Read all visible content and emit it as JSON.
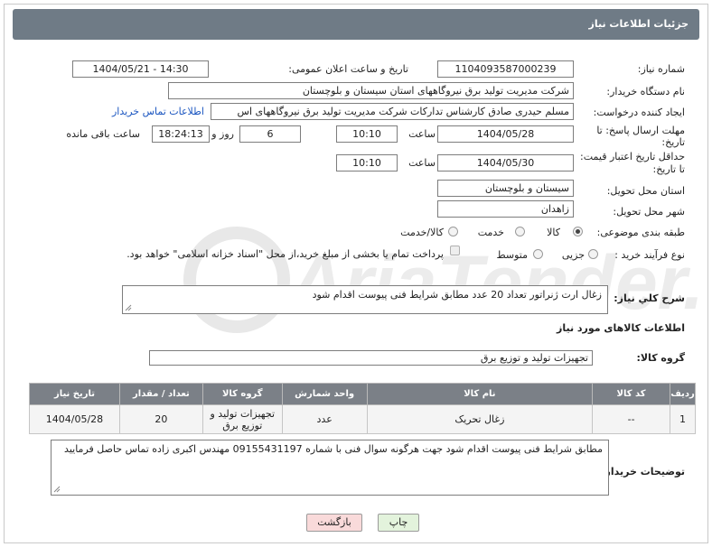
{
  "header": {
    "title": "جزئیات اطلاعات نیاز"
  },
  "fields": {
    "need_number_label": "شماره نیاز:",
    "need_number": "1104093587000239",
    "announce_label": "تاریخ و ساعت اعلان عمومی:",
    "announce_value": "1404/05/21 - 14:30",
    "buyer_org_label": "نام دستگاه خریدار:",
    "buyer_org": "شرکت مدیریت تولید برق نیروگاههای استان سیستان و بلوچستان",
    "creator_label": "ایجاد کننده درخواست:",
    "creator": "مسلم حیدری صادق کارشناس تدارکات شرکت مدیریت تولید برق نیروگاههای اس",
    "contact_link": "اطلاعات تماس خریدار",
    "reply_deadline_label_1": "مهلت ارسال پاسخ: تا",
    "reply_deadline_label_2": "تاریخ:",
    "reply_date": "1404/05/28",
    "time_label": "ساعت",
    "reply_time": "10:10",
    "days_value": "6",
    "days_label": "روز و",
    "remaining_time": "18:24:13",
    "remaining_label": "ساعت باقی مانده",
    "price_deadline_label_1": "حداقل تاریخ اعتبار قیمت:",
    "price_deadline_label_2": "تا تاریخ:",
    "price_date": "1404/05/30",
    "price_time": "10:10",
    "province_label": "استان محل تحویل:",
    "province": "سیستان و بلوچستان",
    "city_label": "شهر محل تحویل:",
    "city": "زاهدان",
    "category_label": "طبقه بندی موضوعی:",
    "category_options": [
      "کالا",
      "خدمت",
      "کالا/خدمت"
    ],
    "process_label": "نوع فرآیند خرید :",
    "process_options": [
      "جزیی",
      "متوسط"
    ],
    "payment_note": "پرداخت تمام یا بخشی از مبلغ خرید،از محل \"اسناد خزانه اسلامی\" خواهد بود."
  },
  "description": {
    "label": "شرح کلي نياز:",
    "text": "زغال ارت ژنراتور   تعداد  20 عدد    مطابق شرایط فنی پیوست اقدام شود"
  },
  "goods_info": {
    "title": "اطلاعات کالاهای مورد نیاز",
    "group_label": "گروه کالا:",
    "group_value": "تجهیزات تولید و توزیع برق"
  },
  "table": {
    "headers": [
      "ردیف",
      "کد کالا",
      "نام کالا",
      "واحد شمارش",
      "گروه کالا",
      "تعداد / مقدار",
      "تاریخ نیاز"
    ],
    "rows": [
      [
        "1",
        "--",
        "زغال تحریک",
        "عدد",
        "تجهیزات تولید و توزیع برق",
        "20",
        "1404/05/28"
      ]
    ]
  },
  "buyer_notes": {
    "label": "توضیحات خریدار:",
    "text": "مطابق شرایط فنی پیوست اقدام شود جهت هرگونه سوال فنی با شماره 09155431197 مهندس  اکبری زاده تماس حاصل فرمایید"
  },
  "buttons": {
    "print": "چاپ",
    "back": "بازگشت"
  },
  "watermark_text": "AriaTender.neT",
  "colors": {
    "header_bg": "#6f7b86",
    "link": "#1a55c0",
    "table_header": "#7b8087",
    "back_button": "#f9dada",
    "print_button": "#e3f3dc"
  }
}
